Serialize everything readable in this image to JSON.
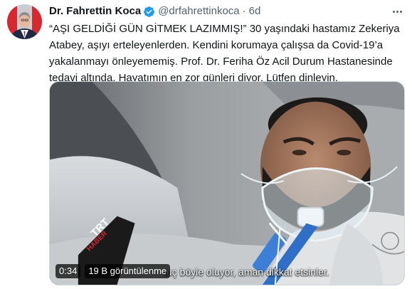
{
  "author": {
    "name": "Dr. Fahrettin Koca",
    "handle": "@drfahrettinkoca",
    "separator": "·",
    "time": "6d"
  },
  "tweet": {
    "lines": [
      "“AŞI GELDİĞİ GÜN GİTMEK LAZIMMIŞ!” 30 yaşındaki hastamız Zekeriya",
      "Atabey, aşıyı erteleyenlerden. Kendini korumaya çalışsa da Covid-19’a",
      "yakalanmayı önleyememiş. Prof. Dr. Feriha Öz Acil Durum Hastanesinde",
      "tedavi altında. Hayatımın en zor günleri diyor. Lütfen dinleyin."
    ]
  },
  "video": {
    "elapsed": "0:34",
    "views": "19 B görüntülenme",
    "subtitle": "ıuç böyle oluyor, aman dikkat etsinler.",
    "logo_text": "TRT HABER"
  },
  "colors": {
    "text": "#0f1419",
    "secondary": "#536471",
    "verified": "#1d9bf0",
    "media_border": "#cfd9de"
  },
  "icons": {
    "verified": "verified-badge-icon",
    "more": "more-icon"
  }
}
